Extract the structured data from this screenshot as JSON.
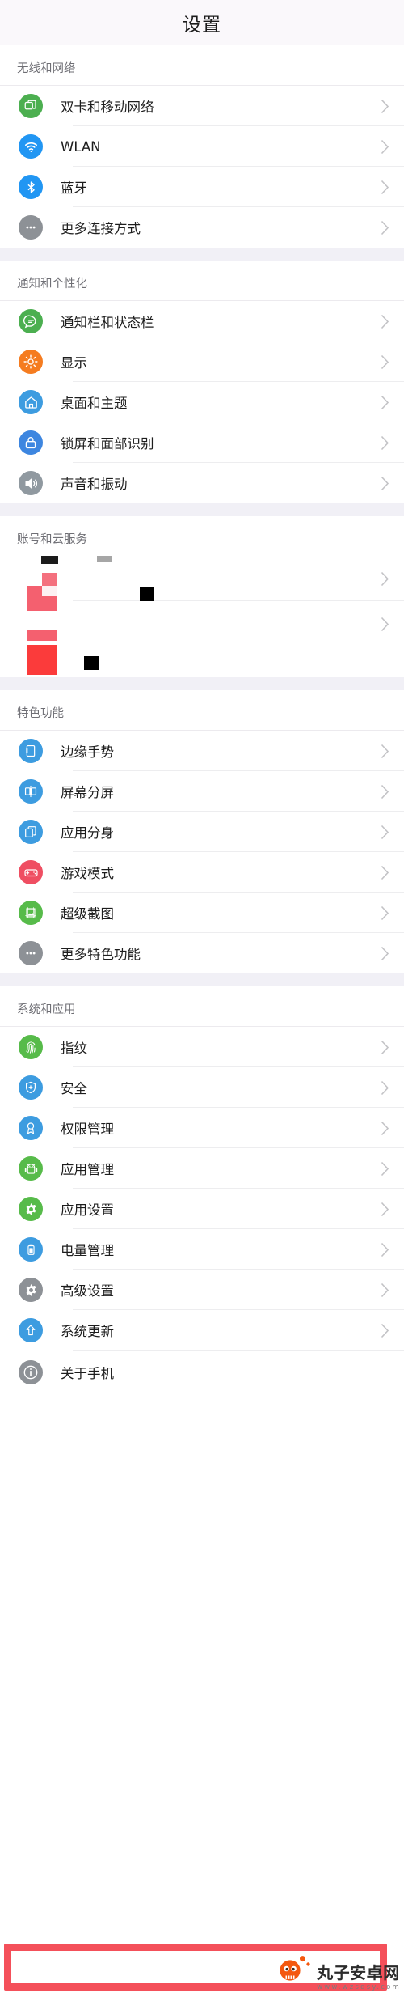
{
  "header": {
    "title": "设置"
  },
  "sections": [
    {
      "key": "wireless",
      "title": "无线和网络",
      "rows": [
        {
          "label": "双卡和移动网络",
          "icon": "sim-card-icon",
          "color": "#4caf50"
        },
        {
          "label": "WLAN",
          "icon": "wifi-icon",
          "color": "#2196f3"
        },
        {
          "label": "蓝牙",
          "icon": "bluetooth-icon",
          "color": "#2196f3"
        },
        {
          "label": "更多连接方式",
          "icon": "more-dots-icon",
          "color": "#8d9196"
        }
      ]
    },
    {
      "key": "notification",
      "title": "通知和个性化",
      "rows": [
        {
          "label": "通知栏和状态栏",
          "icon": "chat-bubble-icon",
          "color": "#4caf50"
        },
        {
          "label": "显示",
          "icon": "brightness-icon",
          "color": "#f57c20"
        },
        {
          "label": "桌面和主题",
          "icon": "home-icon",
          "color": "#3d9ce0"
        },
        {
          "label": "锁屏和面部识别",
          "icon": "lock-icon",
          "color": "#3d86e0"
        },
        {
          "label": "声音和振动",
          "icon": "speaker-icon",
          "color": "#9099a0"
        }
      ]
    },
    {
      "key": "account",
      "title": "账号和云服务",
      "redacted": true,
      "rows": [
        {
          "label": "",
          "icon": "redacted-icon",
          "color": "#ef4e59"
        },
        {
          "label": "",
          "icon": "redacted-icon",
          "color": "#fb3b3b"
        }
      ]
    },
    {
      "key": "features",
      "title": "特色功能",
      "rows": [
        {
          "label": "边缘手势",
          "icon": "edge-gesture-icon",
          "color": "#3d9ce0"
        },
        {
          "label": "屏幕分屏",
          "icon": "split-screen-icon",
          "color": "#3d9ce0"
        },
        {
          "label": "应用分身",
          "icon": "app-clone-icon",
          "color": "#3d9ce0"
        },
        {
          "label": "游戏模式",
          "icon": "gamepad-icon",
          "color": "#ef4e62"
        },
        {
          "label": "超级截图",
          "icon": "screenshot-icon",
          "color": "#57bb4a"
        },
        {
          "label": "更多特色功能",
          "icon": "more-dots-icon",
          "color": "#8d9196"
        }
      ]
    },
    {
      "key": "system",
      "title": "系统和应用",
      "rows": [
        {
          "label": "指纹",
          "icon": "fingerprint-icon",
          "color": "#57bb4a"
        },
        {
          "label": "安全",
          "icon": "shield-icon",
          "color": "#3d9ce0"
        },
        {
          "label": "权限管理",
          "icon": "badge-icon",
          "color": "#3d9ce0"
        },
        {
          "label": "应用管理",
          "icon": "android-robot-icon",
          "color": "#57bb4a"
        },
        {
          "label": "应用设置",
          "icon": "gear-icon",
          "color": "#57bb4a"
        },
        {
          "label": "电量管理",
          "icon": "battery-icon",
          "color": "#3d9ce0"
        },
        {
          "label": "高级设置",
          "icon": "gear-icon",
          "color": "#8d9196"
        },
        {
          "label": "系统更新",
          "icon": "up-arrow-icon",
          "color": "#3d9ce0"
        },
        {
          "label": "关于手机",
          "icon": "info-icon",
          "color": "#8d9196",
          "highlighted": true
        }
      ]
    }
  ],
  "highlight": {
    "color": "#f4505a"
  },
  "watermark": {
    "name": "丸子安卓网",
    "url": "www.wzsqsy.com",
    "mascot_color": "#f4580f"
  }
}
